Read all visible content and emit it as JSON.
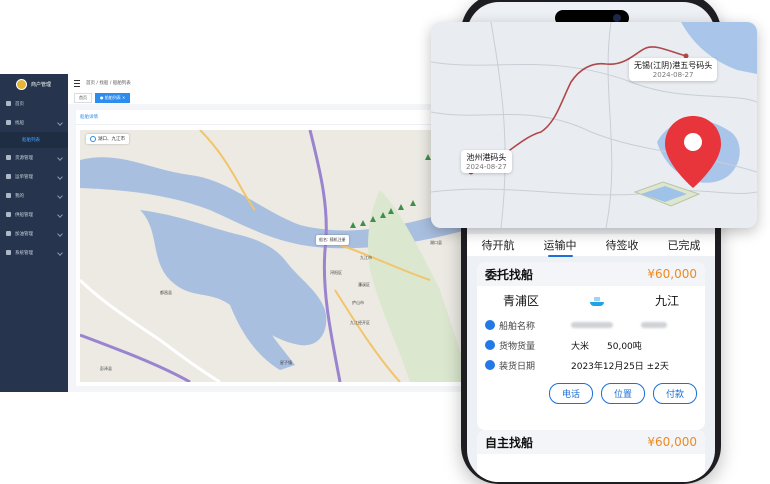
{
  "admin": {
    "brand": "商户管理",
    "nav": [
      {
        "label": "首页",
        "icon": "home-icon",
        "has_children": false
      },
      {
        "label": "找船",
        "icon": "search-icon",
        "has_children": true
      },
      {
        "label": "货源管理",
        "icon": "cargo-icon",
        "has_children": true
      },
      {
        "label": "运单管理",
        "icon": "waybill-icon",
        "has_children": true
      },
      {
        "label": "我的",
        "icon": "user-icon",
        "has_children": true
      },
      {
        "label": "供船管理",
        "icon": "ship-icon",
        "has_children": true
      },
      {
        "label": "加油管理",
        "icon": "fuel-icon",
        "has_children": true
      },
      {
        "label": "系统管理",
        "icon": "gear-icon",
        "has_children": true
      }
    ],
    "nav_sub_active": "船舶列表",
    "breadcrumb": [
      "首页",
      "找船",
      "船舶列表"
    ],
    "tabs": [
      {
        "label": "首页",
        "active": false
      },
      {
        "label": "● 船舶列表 ×",
        "active": true
      }
    ],
    "content_title": "船舶详情",
    "map": {
      "search_value": "湖口、九江市",
      "ship_badge": "船名: 随机注册",
      "labels": [
        "九江市",
        "浔阳区",
        "濂溪区",
        "星子镇",
        "都昌县",
        "庐山市",
        "九江经开区",
        "湖口县",
        "彭泽县"
      ]
    }
  },
  "phone": {
    "status_tabs": [
      {
        "label": "待开航",
        "active": false
      },
      {
        "label": "运输中",
        "active": true
      },
      {
        "label": "待签收",
        "active": false
      },
      {
        "label": "已完成",
        "active": false
      }
    ],
    "cards": [
      {
        "title": "委托找船",
        "price": "¥60,000",
        "origin": "青浦区",
        "destination": "九江",
        "rows": [
          {
            "label": "船舶名称",
            "value": "",
            "icon": "ship-icon"
          },
          {
            "label": "货物货量",
            "value": "大米　　50,00吨",
            "icon": "cargo-icon"
          },
          {
            "label": "装货日期",
            "value": "2023年12月25日 ±2天",
            "icon": "calendar-icon"
          }
        ],
        "buttons": [
          "电话",
          "位置",
          "付款"
        ]
      },
      {
        "title": "自主找船",
        "price": "¥60,000"
      }
    ]
  },
  "route_map": {
    "from": {
      "name": "池州港码头",
      "date": "2024-08-27"
    },
    "to": {
      "name": "无锡(江阴)港五号码头",
      "date": "2024-08-27"
    },
    "accent": "#e8343b",
    "route_color": "#b0474a"
  }
}
